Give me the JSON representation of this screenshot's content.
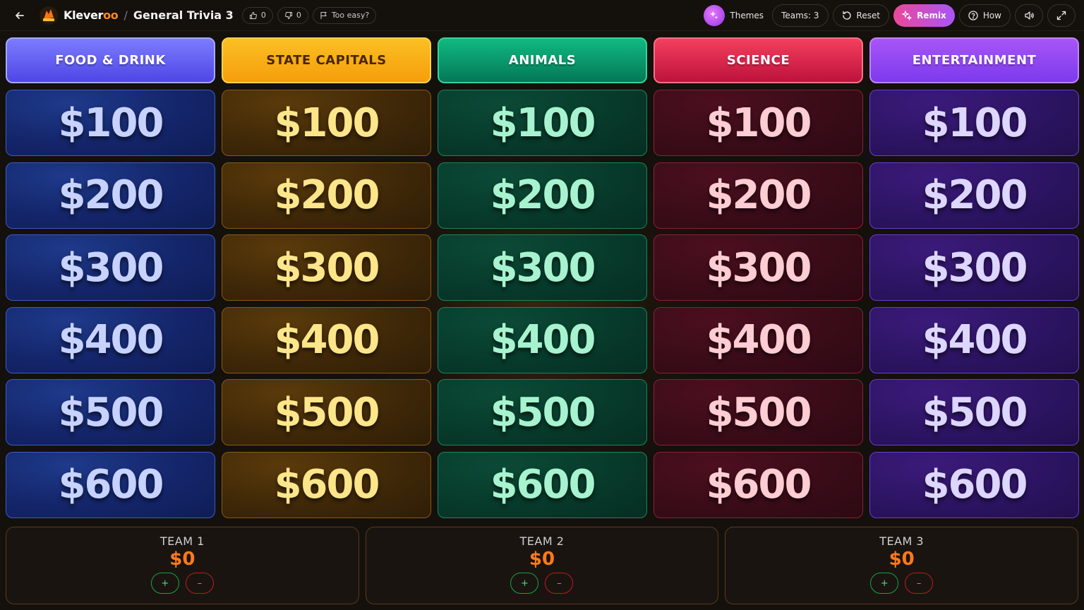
{
  "header": {
    "brand_part1": "Klever",
    "brand_part2": "oo",
    "separator": "/",
    "game_title": "General Trivia 3",
    "likes": "0",
    "dislikes": "0",
    "feedback_label": "Too easy?",
    "themes_label": "Themes",
    "teams_label": "Teams: 3",
    "reset_label": "Reset",
    "remix_label": "Remix",
    "how_label": "How"
  },
  "board": {
    "categories": [
      {
        "name": "FOOD & DRINK",
        "values": [
          "$100",
          "$200",
          "$300",
          "$400",
          "$500",
          "$600"
        ]
      },
      {
        "name": "STATE CAPITALS",
        "values": [
          "$100",
          "$200",
          "$300",
          "$400",
          "$500",
          "$600"
        ]
      },
      {
        "name": "ANIMALS",
        "values": [
          "$100",
          "$200",
          "$300",
          "$400",
          "$500",
          "$600"
        ]
      },
      {
        "name": "SCIENCE",
        "values": [
          "$100",
          "$200",
          "$300",
          "$400",
          "$500",
          "$600"
        ]
      },
      {
        "name": "ENTERTAINMENT",
        "values": [
          "$100",
          "$200",
          "$300",
          "$400",
          "$500",
          "$600"
        ]
      }
    ]
  },
  "teams": [
    {
      "name": "TEAM 1",
      "score": "$0",
      "plus": "+",
      "minus": "–"
    },
    {
      "name": "TEAM 2",
      "score": "$0",
      "plus": "+",
      "minus": "–"
    },
    {
      "name": "TEAM 3",
      "score": "$0",
      "plus": "+",
      "minus": "–"
    }
  ],
  "colors": {
    "accent_orange": "#ff7a1a",
    "food_drink": "#4f46e5",
    "state_capitals": "#f59e0b",
    "animals": "#10b981",
    "science": "#f43f5e",
    "entertainment": "#a855f7"
  }
}
